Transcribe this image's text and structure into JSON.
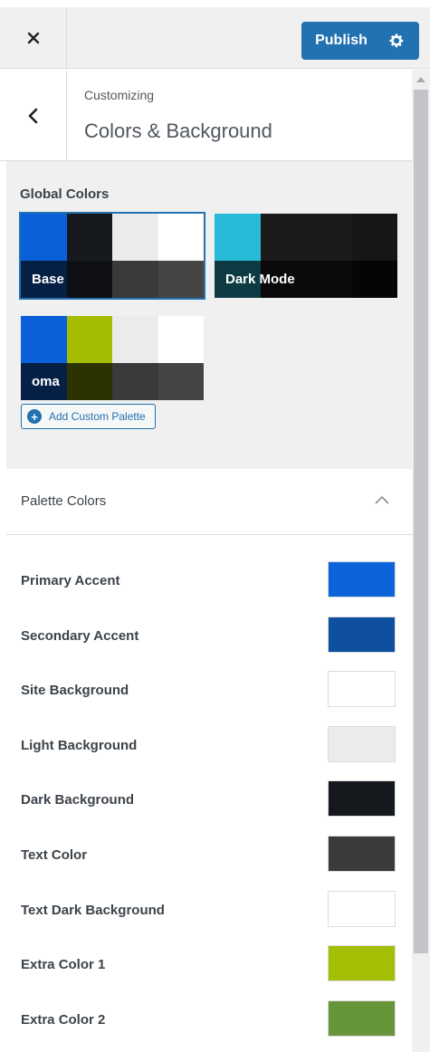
{
  "header": {
    "publish_label": "Publish"
  },
  "title": {
    "crumb": "Customizing",
    "section": "Colors & Background"
  },
  "global_colors": {
    "label": "Global Colors",
    "palettes": [
      {
        "name": "Base",
        "active": true,
        "colors": [
          "#0a60d8",
          "#16191e",
          "#ebebeb",
          "#ffffff"
        ],
        "shade": [
          "#061f45",
          "#0e1014",
          "#3a3a3a",
          "#454545"
        ]
      },
      {
        "name": "Dark Mode",
        "active": false,
        "colors": [
          "#28bbd9",
          "#1a1a1a",
          "#1a1a1a",
          "#161616"
        ],
        "shade": [
          "#0e3a44",
          "#0a0a0a",
          "#0a0a0a",
          "#050505"
        ]
      },
      {
        "name": "oma",
        "active": false,
        "colors": [
          "#0a60d8",
          "#a5bd00",
          "#ebebeb",
          "#ffffff"
        ],
        "shade": [
          "#061f45",
          "#2c3200",
          "#3a3a3a",
          "#454545"
        ]
      }
    ],
    "add_label": "Add Custom Palette"
  },
  "palette_colors": {
    "label": "Palette Colors",
    "items": [
      {
        "label": "Primary Accent",
        "color": "#0d63d9"
      },
      {
        "label": "Secondary Accent",
        "color": "#0f4f9f"
      },
      {
        "label": "Site Background",
        "color": "#ffffff"
      },
      {
        "label": "Light Background",
        "color": "#ececec"
      },
      {
        "label": "Dark Background",
        "color": "#15181d"
      },
      {
        "label": "Text Color",
        "color": "#3a3a3a"
      },
      {
        "label": "Text Dark Background",
        "color": "#ffffff"
      },
      {
        "label": "Extra Color 1",
        "color": "#a4bf03"
      },
      {
        "label": "Extra Color 2",
        "color": "#66953a"
      }
    ]
  }
}
